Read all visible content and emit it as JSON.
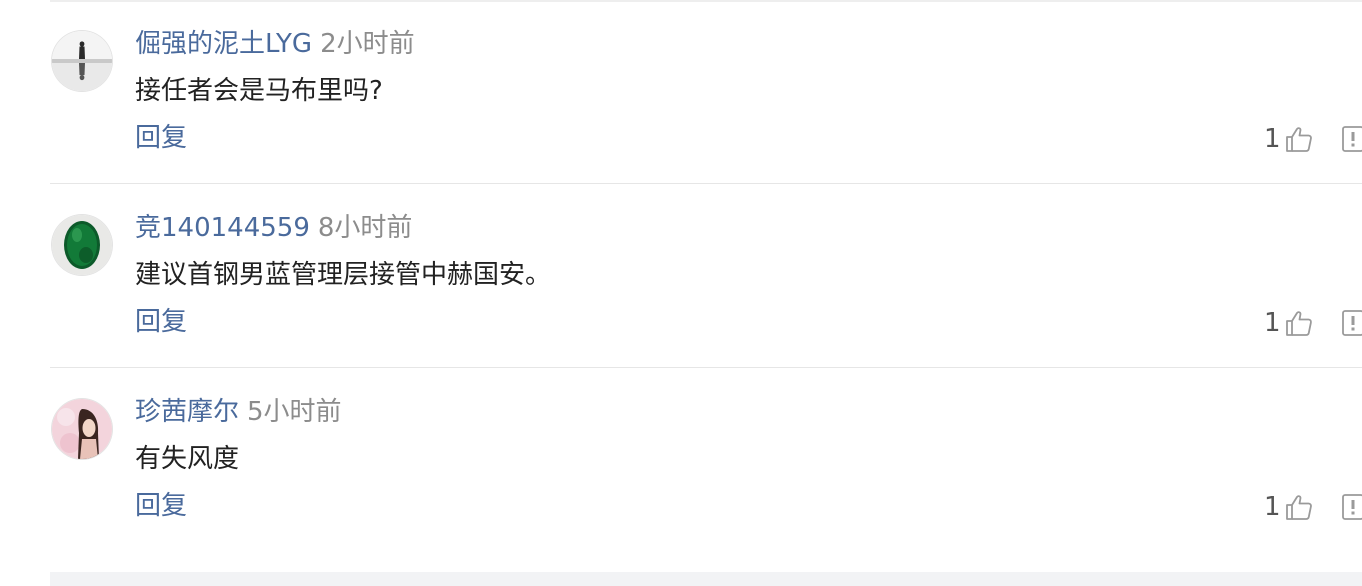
{
  "comments": [
    {
      "username": "倔强的泥土LYG",
      "time": "2小时前",
      "text": "接任者会是马布里吗?",
      "reply_label": "回复",
      "likes": "1",
      "avatar_icon": "silhouette-reflection-avatar"
    },
    {
      "username": "竞140144559",
      "time": "8小时前",
      "text": "建议首钢男蓝管理层接管中赫国安。",
      "reply_label": "回复",
      "likes": "1",
      "avatar_icon": "green-gem-avatar"
    },
    {
      "username": "珍茜摩尔",
      "time": "5小时前",
      "text": "有失风度",
      "reply_label": "回复",
      "likes": "1",
      "avatar_icon": "portrait-woman-avatar"
    }
  ],
  "colors": {
    "username": "#4a6a9c",
    "time": "#8c8c8c",
    "text": "#222222",
    "divider": "#e6e6e6"
  }
}
